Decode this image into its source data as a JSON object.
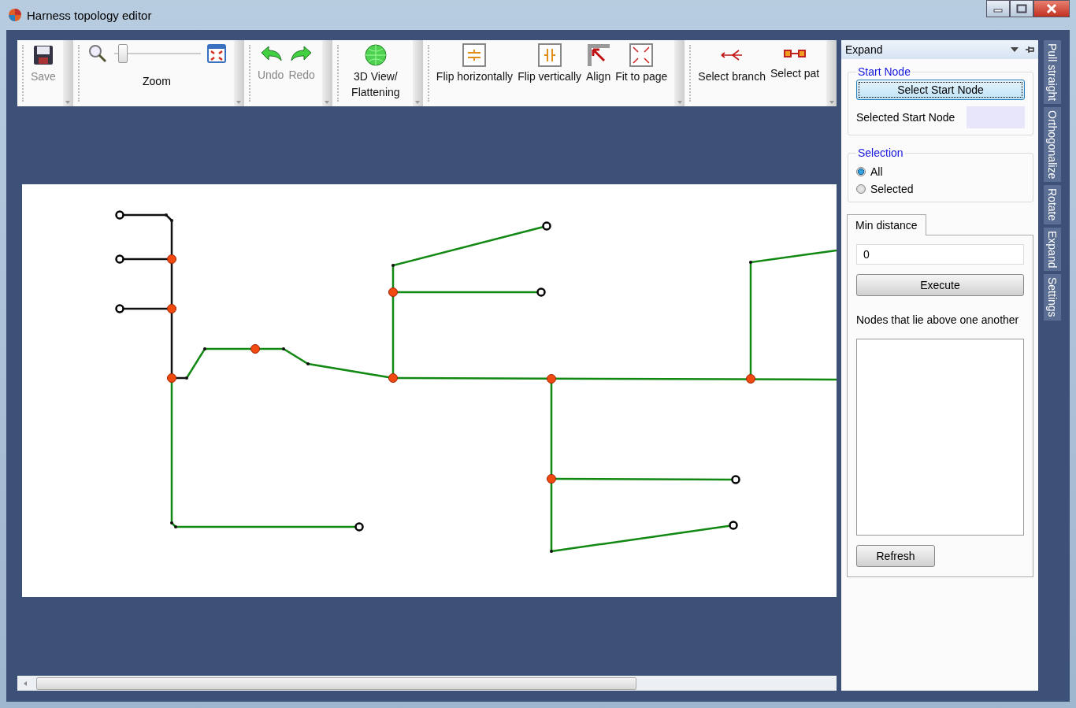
{
  "window": {
    "title": "Harness topology editor"
  },
  "toolbar": {
    "groups": [
      {
        "items": [
          {
            "kind": "button",
            "label": "Save",
            "disabled": true
          }
        ]
      },
      {
        "items": [
          {
            "kind": "zoom",
            "label": "Zoom",
            "level": 0.05,
            "disabled": false
          }
        ]
      },
      {
        "items": [
          {
            "kind": "button",
            "label": "Undo",
            "disabled": true
          },
          {
            "kind": "button",
            "label": "Redo",
            "disabled": true
          }
        ]
      },
      {
        "items": [
          {
            "kind": "button",
            "label": "3D View/ Flattening",
            "disabled": false
          }
        ]
      },
      {
        "items": [
          {
            "kind": "button",
            "label": "Flip horizontally",
            "disabled": false
          },
          {
            "kind": "button",
            "label": "Flip vertically",
            "disabled": false
          },
          {
            "kind": "button",
            "label": "Align",
            "disabled": false
          },
          {
            "kind": "button",
            "label": "Fit to page",
            "disabled": false
          }
        ]
      },
      {
        "items": [
          {
            "kind": "button",
            "label": "Select branch",
            "disabled": false
          },
          {
            "kind": "button",
            "label": "Select pat",
            "disabled": false
          }
        ]
      }
    ]
  },
  "panel": {
    "title": "Expand",
    "start_node": {
      "legend": "Start Node",
      "button": "Select Start Node",
      "label": "Selected Start Node"
    },
    "selection": {
      "legend": "Selection",
      "options": [
        {
          "label": "All",
          "selected": true
        },
        {
          "label": "Selected",
          "selected": false
        }
      ]
    },
    "tabs": [
      {
        "label": "Min distance",
        "selected": true
      }
    ],
    "distance": {
      "value": "0"
    },
    "execute": "Execute",
    "note": "Nodes that lie above one another",
    "refresh": "Refresh"
  },
  "side_tabs": [
    "Pull straight",
    "Orthogonalize",
    "Rotate",
    "Expand",
    "Settings"
  ]
}
